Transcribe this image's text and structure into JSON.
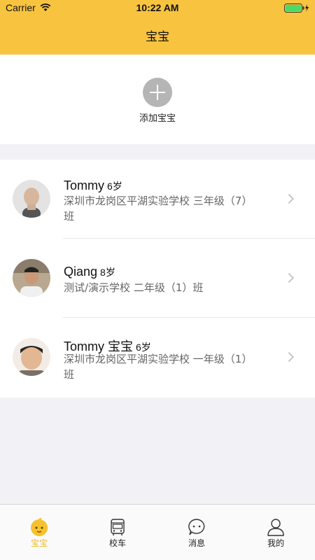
{
  "status_bar": {
    "carrier": "Carrier",
    "time": "10:22 AM"
  },
  "nav": {
    "title": "宝宝"
  },
  "add_baby": {
    "label": "添加宝宝",
    "icon": "plus-icon"
  },
  "children": [
    {
      "name": "Tommy",
      "age": "6岁",
      "school": "深圳市龙岗区平湖实验学校 三年级（7）班"
    },
    {
      "name": "Qiang",
      "age": "8岁",
      "school": "测试/演示学校 二年级（1）班"
    },
    {
      "name": "Tommy 宝宝",
      "age": "6岁",
      "school": "深圳市龙岗区平湖实验学校 一年级（1）班"
    }
  ],
  "tabs": [
    {
      "label": "宝宝",
      "icon": "baby-face-icon",
      "active": true
    },
    {
      "label": "校车",
      "icon": "bus-icon",
      "active": false
    },
    {
      "label": "消息",
      "icon": "chat-bubble-icon",
      "active": false
    },
    {
      "label": "我的",
      "icon": "person-icon",
      "active": false
    }
  ],
  "colors": {
    "brand_yellow": "#f8c43f",
    "tab_active": "#f0b829",
    "background": "#f2f2f6"
  }
}
